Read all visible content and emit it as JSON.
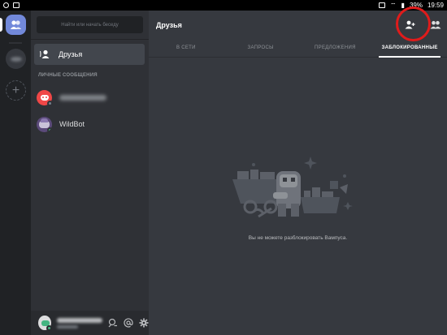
{
  "statusbar": {
    "battery": "39%",
    "time": "19:59"
  },
  "rail": {
    "home_icon": "discord-friends-icon",
    "add_icon": "plus-icon",
    "add_label": "+"
  },
  "channels": {
    "search_placeholder": "Найти или начать беседу",
    "friends_label": "Друзья",
    "dm_header": "ЛИЧНЫЕ СООБЩЕНИЯ",
    "dms": [
      {
        "name": "",
        "status": "offline"
      },
      {
        "name": "WildBot",
        "status": "online"
      }
    ]
  },
  "userbar": {
    "icons": [
      "headset-icon",
      "mention-icon",
      "settings-gear-icon"
    ]
  },
  "main": {
    "title": "Друзья",
    "tabs": [
      "В СЕТИ",
      "ЗАПРОСЫ",
      "ПРЕДЛОЖЕНИЯ",
      "ЗАБЛОКИРОВАННЫЕ"
    ],
    "active_tab": "ЗАБЛОКИРОВАННЫЕ",
    "empty_message": "Вы не можете разблокировать Вампуса.",
    "toolbar_icons": [
      "add-friend-icon",
      "new-group-dm-icon"
    ]
  },
  "colors": {
    "accent": "#7289da",
    "highlight": "#e01b1b",
    "online": "#43b581"
  }
}
